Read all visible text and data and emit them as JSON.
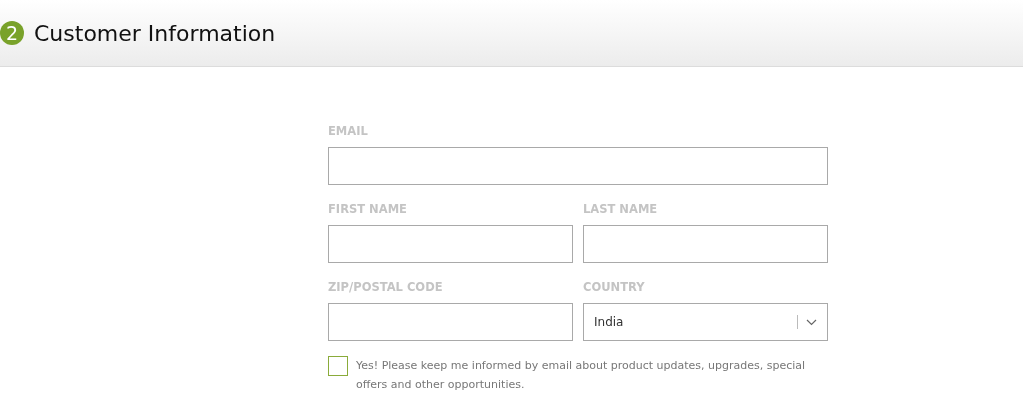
{
  "header": {
    "step": "2",
    "title": "Customer Information"
  },
  "form_rows": [
    [
      {
        "kind": "text",
        "label": "EMAIL"
      }
    ],
    [
      {
        "kind": "text",
        "label": "FIRST NAME"
      },
      {
        "kind": "text",
        "label": "LAST NAME"
      }
    ],
    [
      {
        "kind": "text",
        "label": "ZIP/POSTAL CODE"
      },
      {
        "kind": "select",
        "label": "COUNTRY",
        "value": "India"
      }
    ]
  ],
  "newsletter": {
    "label": "Yes! Please keep me informed by email about product updates, upgrades, special offers and other opportunities.",
    "checked": false
  }
}
